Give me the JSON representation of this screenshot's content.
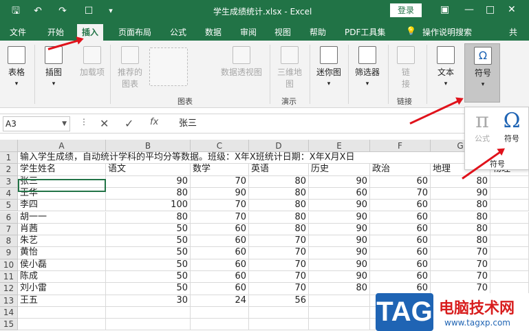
{
  "titlebar": {
    "title": "学生成绩统计.xlsx  -  Excel",
    "login": "登录",
    "quick_access": [
      "save-icon",
      "undo-icon",
      "redo-icon",
      "print-preview-icon",
      "customize-icon"
    ],
    "accent": "#217346"
  },
  "menu": {
    "tabs": [
      "文件",
      "开始",
      "插入",
      "页面布局",
      "公式",
      "数据",
      "审阅",
      "视图",
      "帮助",
      "PDF工具集",
      "操作说明搜索",
      "共"
    ],
    "active": "插入"
  },
  "ribbon": {
    "table": "表格",
    "illustrations": "插图",
    "addins": "加载项",
    "rec_chart_l1": "推荐的",
    "rec_chart_l2": "图表",
    "pivot_chart": "数据透视图",
    "chart_group": "图表",
    "map3d_l1": "三维地",
    "map3d_l2": "图",
    "tours_group": "演示",
    "sparkline": "迷你图",
    "filter": "筛选器",
    "link_l1": "链",
    "link_l2": "接",
    "links_group": "链接",
    "text": "文本",
    "symbol": "符号"
  },
  "formula_bar": {
    "name_box": "A3",
    "fx": "fx",
    "value": "张三"
  },
  "grid": {
    "columns": [
      "A",
      "B",
      "C",
      "D",
      "E",
      "F",
      "G"
    ],
    "rows": [
      "1",
      "2",
      "3",
      "4",
      "5",
      "6",
      "7",
      "8",
      "9",
      "10",
      "11",
      "12",
      "13",
      "14",
      "15"
    ],
    "row1": "输入学生成绩，自动统计学科的平均分等数据。班级：X年X班统计日期：X年X月X日",
    "headers": [
      "学生姓名",
      "语文",
      "数学",
      "英语",
      "历史",
      "政治",
      "地理",
      "物理"
    ],
    "data": [
      [
        "张三",
        "90",
        "70",
        "80",
        "90",
        "60",
        "80"
      ],
      [
        "王华",
        "80",
        "90",
        "80",
        "60",
        "70",
        "90"
      ],
      [
        "李四",
        "100",
        "70",
        "80",
        "90",
        "60",
        "80"
      ],
      [
        "胡一一",
        "80",
        "70",
        "80",
        "90",
        "60",
        "80"
      ],
      [
        "肖茜",
        "50",
        "60",
        "80",
        "90",
        "60",
        "80"
      ],
      [
        "朱艺",
        "50",
        "60",
        "70",
        "90",
        "60",
        "80"
      ],
      [
        "黄怡",
        "50",
        "60",
        "70",
        "90",
        "60",
        "70"
      ],
      [
        "侯小磊",
        "50",
        "60",
        "70",
        "90",
        "60",
        "70"
      ],
      [
        "陈成",
        "50",
        "60",
        "70",
        "90",
        "60",
        "70"
      ],
      [
        "刘小雷",
        "50",
        "60",
        "70",
        "80",
        "60",
        "70"
      ],
      [
        "王五",
        "30",
        "24",
        "56",
        "",
        "",
        ""
      ]
    ]
  },
  "symbol_popup": {
    "formula_glyph": "π",
    "formula_label": "公式",
    "symbol_glyph": "Ω",
    "symbol_label": "符号",
    "group_label": "符号"
  },
  "watermark": {
    "logo": "TAG",
    "text": "电脑技术网",
    "url": "www.tagxp.com"
  }
}
